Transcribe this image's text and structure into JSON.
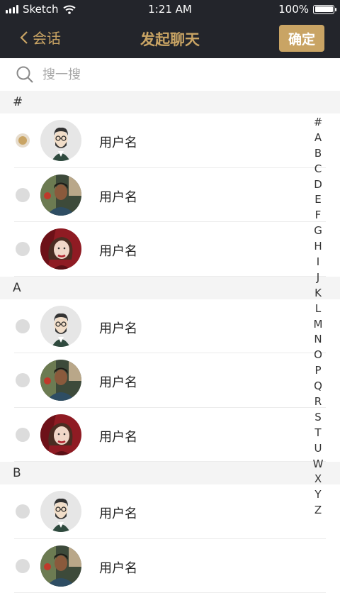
{
  "status": {
    "carrier": "Sketch",
    "time": "1:21 AM",
    "battery": "100%"
  },
  "nav": {
    "back_label": "会话",
    "title": "发起聊天",
    "confirm_label": "确定"
  },
  "search": {
    "placeholder": "搜一搜"
  },
  "sections": [
    {
      "header": "#",
      "rows": [
        {
          "name": "用户名",
          "avatar": "man-illustration",
          "selected": true
        },
        {
          "name": "用户名",
          "avatar": "woman-photo",
          "selected": false
        },
        {
          "name": "用户名",
          "avatar": "woman-portrait",
          "selected": false
        }
      ]
    },
    {
      "header": "A",
      "rows": [
        {
          "name": "用户名",
          "avatar": "man-illustration",
          "selected": false
        },
        {
          "name": "用户名",
          "avatar": "woman-photo",
          "selected": false
        },
        {
          "name": "用户名",
          "avatar": "woman-portrait",
          "selected": false
        }
      ]
    },
    {
      "header": "B",
      "rows": [
        {
          "name": "用户名",
          "avatar": "man-illustration",
          "selected": false
        },
        {
          "name": "用户名",
          "avatar": "woman-photo",
          "selected": false
        }
      ]
    }
  ],
  "index_letters": [
    "#",
    "A",
    "B",
    "C",
    "D",
    "E",
    "F",
    "G",
    "H",
    "I",
    "J",
    "K",
    "L",
    "M",
    "N",
    "O",
    "P",
    "Q",
    "R",
    "S",
    "T",
    "U",
    "W",
    "X",
    "Y",
    "Z"
  ],
  "colors": {
    "nav_bg": "#23252b",
    "accent": "#c9a464",
    "section_bg": "#f4f4f4"
  }
}
